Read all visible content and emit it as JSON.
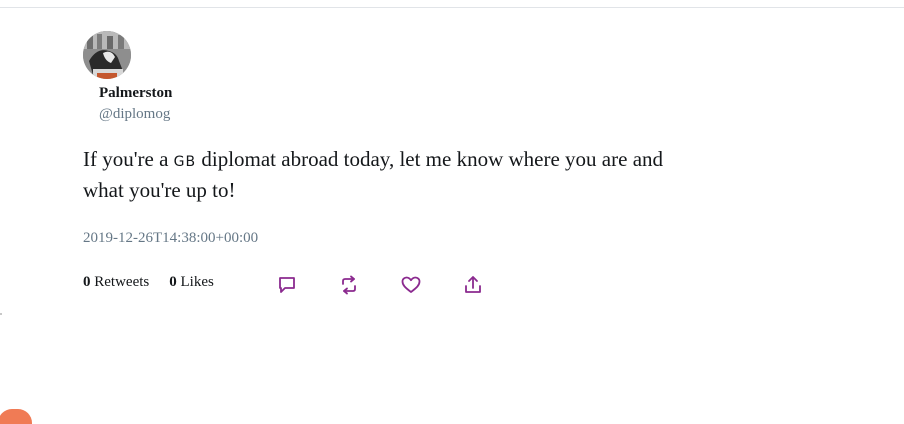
{
  "tweet": {
    "author": {
      "display_name": "Palmerston",
      "handle": "@diplomog"
    },
    "text_before_flag": "If you're a ",
    "flag": "GB",
    "text_after_flag": " diplomat abroad today, let me know where you are and what you're up to!",
    "timestamp": "2019-12-26T14:38:00+00:00",
    "retweets_count": "0",
    "retweets_label": "Retweets",
    "likes_count": "0",
    "likes_label": "Likes"
  },
  "actions": [
    {
      "name": "reply",
      "icon": "reply-icon"
    },
    {
      "name": "retweet",
      "icon": "retweet-icon"
    },
    {
      "name": "like",
      "icon": "heart-icon"
    },
    {
      "name": "share",
      "icon": "share-icon"
    }
  ],
  "colors": {
    "action_icon": "#8b2a8f",
    "secondary_text": "#657786",
    "primary_text": "#14171a",
    "accent_badge": "#f07b55"
  }
}
